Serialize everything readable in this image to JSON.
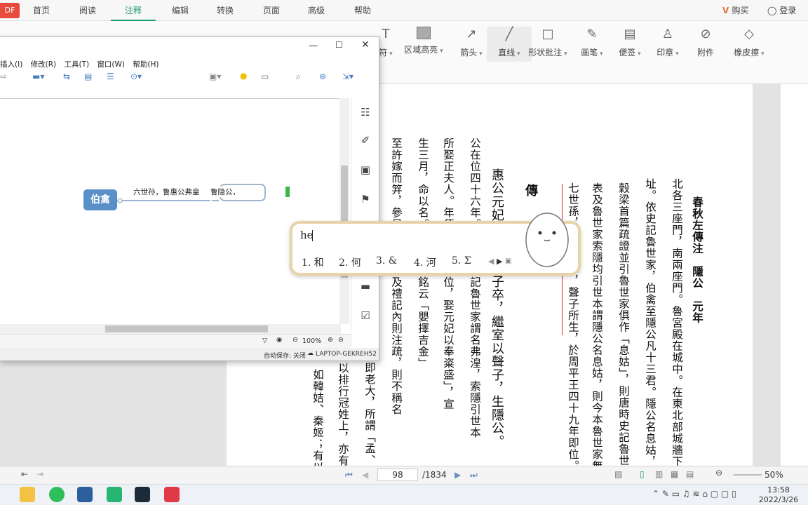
{
  "app_badge": "DF",
  "tabs": [
    "首页",
    "阅读",
    "注释",
    "编辑",
    "转换",
    "页面",
    "高级",
    "帮助"
  ],
  "active_tab": "注释",
  "account": {
    "buy": "购买",
    "login": "登录"
  },
  "ribbon": [
    {
      "label": "符",
      "icon": "text-icon",
      "dropdown": true
    },
    {
      "label": "区域高亮",
      "icon": "area-highlight-icon",
      "dropdown": true
    },
    {
      "label": "箭头",
      "icon": "arrow-icon",
      "dropdown": true
    },
    {
      "label": "直线",
      "icon": "line-icon",
      "dropdown": true
    },
    {
      "label": "形状批注",
      "icon": "shape-icon",
      "dropdown": true
    },
    {
      "label": "画笔",
      "icon": "pen-icon",
      "dropdown": true
    },
    {
      "label": "便签",
      "icon": "note-icon",
      "dropdown": true
    },
    {
      "label": "印章",
      "icon": "stamp-icon",
      "dropdown": true
    },
    {
      "label": "附件",
      "icon": "attachment-icon",
      "dropdown": false
    },
    {
      "label": "橡皮擦",
      "icon": "eraser-icon",
      "dropdown": true
    }
  ],
  "mindmap": {
    "menu": [
      "插入(I)",
      "修改(R)",
      "工具(T)",
      "窗口(W)",
      "帮助(H)"
    ],
    "root": "伯禽",
    "branch_text": "六世孙，鲁惠公弗皇",
    "editing_text": "鲁隐公，",
    "zoom": "100%",
    "autosave": "自动保存: 关闭",
    "computer": "LAPTOP-GEKREH52"
  },
  "ime": {
    "input": "he",
    "candidates": [
      "1. 和",
      "2. 何",
      "3. &",
      "4. 河",
      "5. Σ"
    ]
  },
  "document": {
    "columns": [
      "春秋左傳注　隱公　元年",
      "北各三座門，南兩座門。魯宮殿在城中。在東北部城牆下發",
      "址。依史記魯世家，伯禽至隱公凡十三君。隱公名息姑，公",
      "穀梁首篇疏證並引魯世家俱作「息姑」，則唐時史記魯世家",
      "表及魯世家索隱均引世本謂隱公名息姑，則今本魯世家無",
      "七世孫，孝公之子，聲子所生，於周平王四十九年即位。",
      "傳",
      "惠公元妃孟子，孟子卒，繼室以聲子，生隱公。",
      "公在位四十六年。惠公，史記魯世家謂名弗湟，索隱引世本",
      "所娶正夫人。年傳「凡君即位，娶元妃以奉粢盛」，宣",
      "生三月，命以名。如陳逆簠銘云「嬰擇吉金」",
      "至許嫁而笄，參見昏禮正義及禮記內則注疏，則不稱名"
    ],
    "left_columns": [
      "即老大，所謂「孟、仲、",
      "是以排行冠姓上，亦有",
      "如韓姞、秦姬；有以"
    ]
  },
  "nav": {
    "current_page": "98",
    "total": "/1834",
    "zoom": "50%"
  },
  "clock": {
    "time": "13:58",
    "date": "2022/3/26"
  }
}
